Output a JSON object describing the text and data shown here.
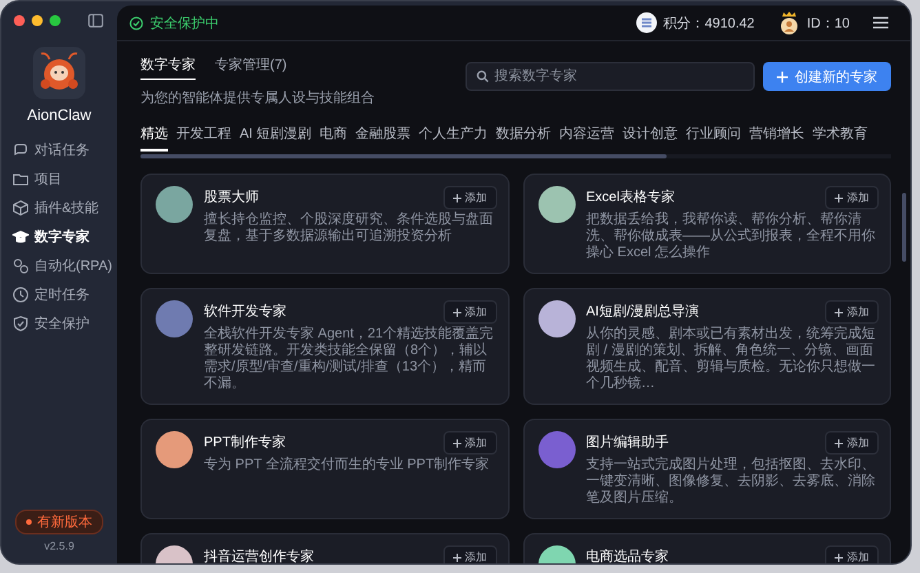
{
  "app": {
    "name": "AionClaw",
    "version": "v2.5.9",
    "update_badge": "有新版本"
  },
  "sidebar": {
    "items": [
      {
        "label": "对话任务",
        "selected": false
      },
      {
        "label": "项目",
        "selected": false
      },
      {
        "label": "插件&技能",
        "selected": false
      },
      {
        "label": "数字专家",
        "selected": true
      },
      {
        "label": "自动化(RPA)",
        "selected": false
      },
      {
        "label": "定时任务",
        "selected": false
      },
      {
        "label": "安全保护",
        "selected": false
      }
    ]
  },
  "top_bar": {
    "status": "安全保护中",
    "points": "积分：4910.42",
    "user_id": "ID：10"
  },
  "header": {
    "tabs": [
      {
        "label": "数字专家",
        "selected": true
      },
      {
        "label": "专家管理(7)",
        "selected": false
      }
    ],
    "subtitle": "为您的智能体提供专属人设与技能组合",
    "search": {
      "placeholder": "搜索数字专家"
    },
    "create_button": "创建新的专家"
  },
  "categories": [
    {
      "label": "精选",
      "selected": true
    },
    {
      "label": "开发工程",
      "selected": false
    },
    {
      "label": "AI 短剧漫剧",
      "selected": false
    },
    {
      "label": "电商",
      "selected": false
    },
    {
      "label": "金融股票",
      "selected": false
    },
    {
      "label": "个人生产力",
      "selected": false
    },
    {
      "label": "数据分析",
      "selected": false
    },
    {
      "label": "内容运营",
      "selected": false
    },
    {
      "label": "设计创意",
      "selected": false
    },
    {
      "label": "行业顾问",
      "selected": false
    },
    {
      "label": "营销增长",
      "selected": false
    },
    {
      "label": "学术教育",
      "selected": false
    }
  ],
  "experts": [
    {
      "name": "股票大师",
      "description": "擅长持仓监控、个股深度研究、条件选股与盘面复盘，基于多数据源输出可追溯投资分析",
      "add": "添加"
    },
    {
      "name": "Excel表格专家",
      "description": "把数据丢给我，我帮你读、帮你分析、帮你清洗、帮你做成表——从公式到报表，全程不用你操心 Excel 怎么操作",
      "add": "添加"
    },
    {
      "name": "软件开发专家",
      "description": "全栈软件开发专家 Agent，21个精选技能覆盖完整研发链路。开发类技能全保留（8个），辅以需求/原型/审查/重构/测试/排查（13个），精而不漏。",
      "add": "添加"
    },
    {
      "name": "AI短剧/漫剧总导演",
      "description": "从你的灵感、剧本或已有素材出发，统筹完成短剧 / 漫剧的策划、拆解、角色统一、分镜、画面视频生成、配音、剪辑与质检。无论你只想做一个几秒镜…",
      "add": "添加"
    },
    {
      "name": "PPT制作专家",
      "description": "专为 PPT 全流程交付而生的专业 PPT制作专家",
      "add": "添加"
    },
    {
      "name": "图片编辑助手",
      "description": "支持一站式完成图片处理，包括抠图、去水印、一键变清晰、图像修复、去阴影、去雾底、消除笔及图片压缩。",
      "add": "添加"
    },
    {
      "name": "抖音运营创作专家",
      "add": "添加"
    },
    {
      "name": "电商选品专家",
      "add": "添加"
    }
  ]
}
